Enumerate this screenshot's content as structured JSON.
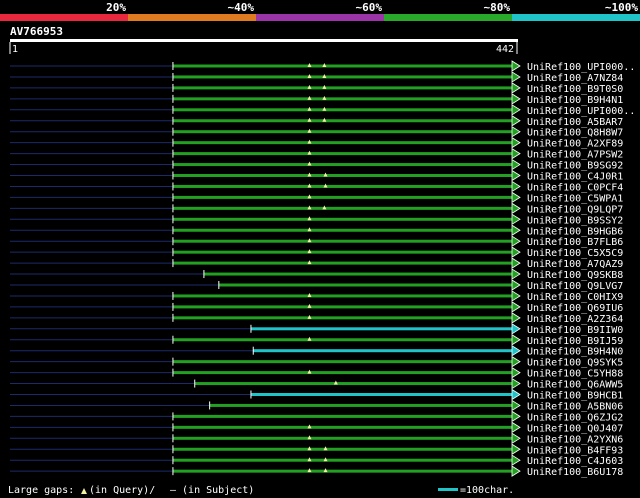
{
  "legend_scale": {
    "labels": [
      "20%",
      "~40%",
      "~60%",
      "~80%",
      "~100%"
    ],
    "colors": [
      "#e8283c",
      "#e07a20",
      "#9b34a6",
      "#2aa82a",
      "#1fc4c8"
    ]
  },
  "query": {
    "id": "AV766953",
    "start_label": "1",
    "end_label": "442",
    "length": 442
  },
  "colors": {
    "background": "#000000",
    "hit_bar_80": "#22a022",
    "hit_bar_100": "#1fc4c8",
    "unaligned": "#1c2a6a",
    "arrow_outline": "#ffffff",
    "marker": "#f0f0a0"
  },
  "hits": [
    {
      "label": "UniRef100_UPI000..",
      "start": 143,
      "color": "green",
      "markers": [
        262,
        275
      ]
    },
    {
      "label": "UniRef100_A7NZ84",
      "start": 143,
      "color": "green",
      "markers": [
        262,
        275
      ]
    },
    {
      "label": "UniRef100_B9T0S0",
      "start": 143,
      "color": "green",
      "markers": [
        262,
        275
      ]
    },
    {
      "label": "UniRef100_B9H4N1",
      "start": 143,
      "color": "green",
      "markers": [
        262,
        275
      ]
    },
    {
      "label": "UniRef100_UPI000..",
      "start": 143,
      "color": "green",
      "markers": [
        262,
        275
      ]
    },
    {
      "label": "UniRef100_A5BAR7",
      "start": 143,
      "color": "green",
      "markers": [
        262,
        275
      ]
    },
    {
      "label": "UniRef100_Q8H8W7",
      "start": 143,
      "color": "green",
      "markers": [
        262
      ]
    },
    {
      "label": "UniRef100_A2XF89",
      "start": 143,
      "color": "green",
      "markers": [
        262
      ]
    },
    {
      "label": "UniRef100_A7PSW2",
      "start": 143,
      "color": "green",
      "markers": [
        262
      ]
    },
    {
      "label": "UniRef100_B9SG92",
      "start": 143,
      "color": "green",
      "markers": [
        262
      ]
    },
    {
      "label": "UniRef100_C4J0R1",
      "start": 143,
      "color": "green",
      "markers": [
        262,
        276
      ]
    },
    {
      "label": "UniRef100_C0PCF4",
      "start": 143,
      "color": "green",
      "markers": [
        262,
        276
      ]
    },
    {
      "label": "UniRef100_C5WPA1",
      "start": 143,
      "color": "green",
      "markers": [
        262
      ]
    },
    {
      "label": "UniRef100_Q9LQP7",
      "start": 143,
      "color": "green",
      "markers": [
        262,
        275
      ]
    },
    {
      "label": "UniRef100_B9SSY2",
      "start": 143,
      "color": "green",
      "markers": [
        262
      ]
    },
    {
      "label": "UniRef100_B9HGB6",
      "start": 143,
      "color": "green",
      "markers": [
        262
      ]
    },
    {
      "label": "UniRef100_B7FLB6",
      "start": 143,
      "color": "green",
      "markers": [
        262
      ]
    },
    {
      "label": "UniRef100_C5X5C9",
      "start": 143,
      "color": "green",
      "markers": [
        262
      ]
    },
    {
      "label": "UniRef100_A7QAZ9",
      "start": 143,
      "color": "green",
      "markers": [
        262
      ]
    },
    {
      "label": "UniRef100_Q9SKB8",
      "start": 170,
      "color": "green",
      "markers": []
    },
    {
      "label": "UniRef100_Q9LVG7",
      "start": 183,
      "color": "green",
      "markers": []
    },
    {
      "label": "UniRef100_C0HIX9",
      "start": 143,
      "color": "green",
      "markers": [
        262
      ]
    },
    {
      "label": "UniRef100_Q69IU6",
      "start": 143,
      "color": "green",
      "markers": [
        262
      ]
    },
    {
      "label": "UniRef100_A2Z364",
      "start": 143,
      "color": "green",
      "markers": [
        262
      ]
    },
    {
      "label": "UniRef100_B9IIW0",
      "start": 211,
      "color": "cyan",
      "markers": []
    },
    {
      "label": "UniRef100_B9IJ59",
      "start": 143,
      "color": "green",
      "markers": [
        262
      ]
    },
    {
      "label": "UniRef100_B9H4N0",
      "start": 213,
      "color": "cyan",
      "markers": []
    },
    {
      "label": "UniRef100_Q9SYK5",
      "start": 143,
      "color": "green",
      "markers": []
    },
    {
      "label": "UniRef100_C5YH88",
      "start": 143,
      "color": "green",
      "markers": [
        262
      ]
    },
    {
      "label": "UniRef100_Q6AWW5",
      "start": 162,
      "color": "green",
      "markers": [
        285
      ]
    },
    {
      "label": "UniRef100_B9HCB1",
      "start": 211,
      "color": "cyan",
      "markers": []
    },
    {
      "label": "UniRef100_A5BN06",
      "start": 175,
      "color": "green",
      "markers": []
    },
    {
      "label": "UniRef100_Q6ZJG2",
      "start": 143,
      "color": "green",
      "markers": []
    },
    {
      "label": "UniRef100_Q0J407",
      "start": 143,
      "color": "green",
      "markers": [
        262
      ]
    },
    {
      "label": "UniRef100_A2YXN6",
      "start": 143,
      "color": "green",
      "markers": [
        262
      ]
    },
    {
      "label": "UniRef100_B4FF93",
      "start": 143,
      "color": "green",
      "markers": [
        262,
        276
      ]
    },
    {
      "label": "UniRef100_C4J603",
      "start": 143,
      "color": "green",
      "markers": [
        262,
        276
      ]
    },
    {
      "label": "UniRef100_B6U178",
      "start": 143,
      "color": "green",
      "markers": [
        262,
        276
      ]
    }
  ],
  "footer": {
    "large_gaps_prefix": "Large gaps: ",
    "in_query": "(in Query)/",
    "in_subject": "– (in Subject)",
    "scale_text": "=100char."
  }
}
